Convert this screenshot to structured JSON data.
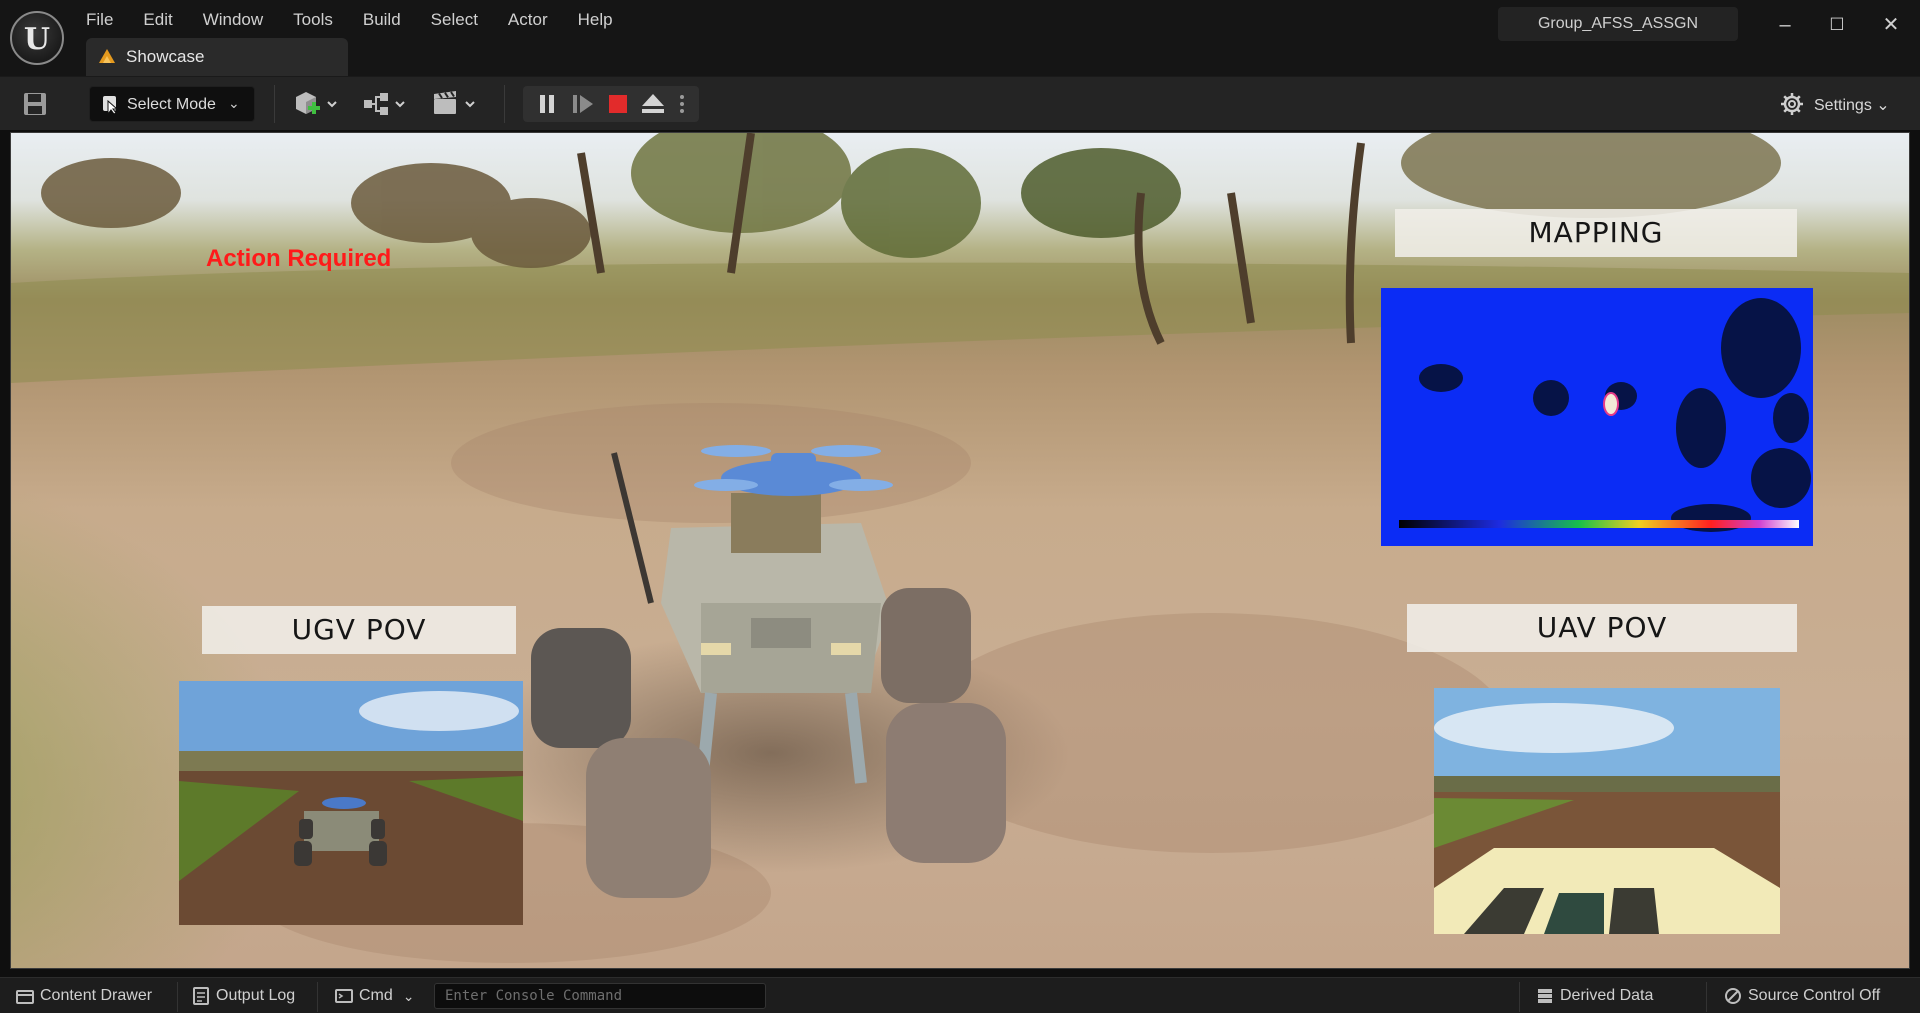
{
  "window": {
    "project_name": "Group_AFSS_ASSGN",
    "tab_label": "Showcase",
    "minimize_glyph": "–",
    "maximize_glyph": "☐",
    "close_glyph": "✕"
  },
  "menu": [
    "File",
    "Edit",
    "Window",
    "Tools",
    "Build",
    "Select",
    "Actor",
    "Help"
  ],
  "toolbar": {
    "select_mode_label": "Select Mode",
    "settings_label": "Settings",
    "chevron": "⌄"
  },
  "viewport": {
    "action_required": "Action Required",
    "mapping_label": "MAPPING",
    "ugv_label": "UGV  POV",
    "uav_label": "UAV  POV"
  },
  "bottombar": {
    "content_drawer": "Content Drawer",
    "output_log": "Output Log",
    "cmd": "Cmd",
    "console_placeholder": "Enter Console Command",
    "derived_data": "Derived Data",
    "source_control": "Source Control Off"
  },
  "colors": {
    "action_required": "#ff1a1a",
    "stop_button": "#e22b2b",
    "mapping_background": "#0b2cf5",
    "add_actor_accent": "#3fbf3f"
  }
}
